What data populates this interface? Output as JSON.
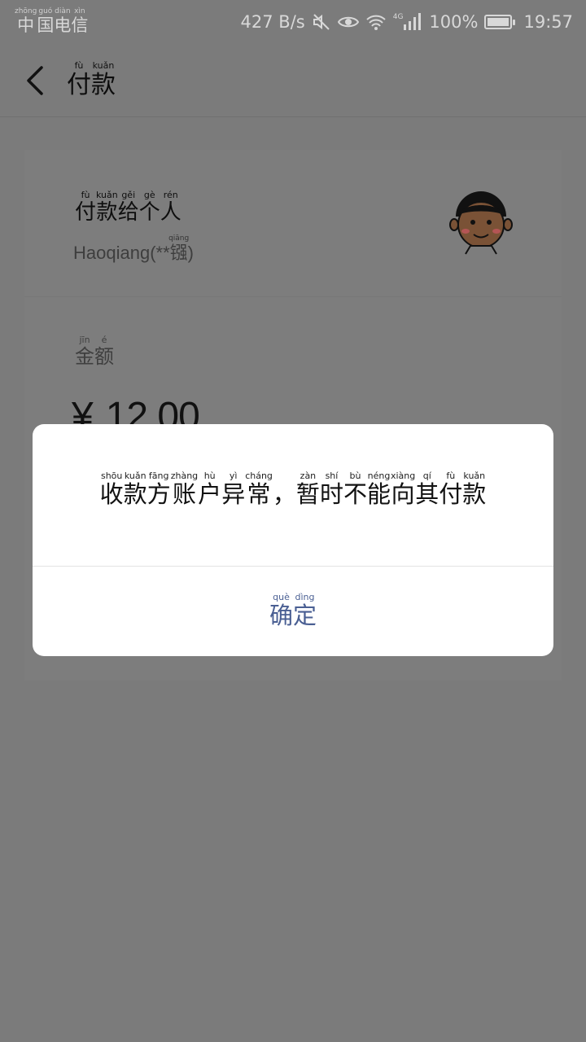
{
  "status_bar": {
    "carrier": [
      {
        "char": "中",
        "pinyin": "zhōng"
      },
      {
        "char": "国",
        "pinyin": "guó"
      },
      {
        "char": "电",
        "pinyin": "diàn"
      },
      {
        "char": "信",
        "pinyin": "xìn"
      }
    ],
    "network_speed": "427 B/s",
    "network_type": "4G",
    "battery": "100%",
    "time": "19:57",
    "icons": [
      "mute-icon",
      "eye-icon",
      "wifi-icon",
      "signal-icon",
      "battery-icon"
    ]
  },
  "header": {
    "back_icon": "chevron-left-icon",
    "title": [
      {
        "char": "付",
        "pinyin": "fù"
      },
      {
        "char": "款",
        "pinyin": "kuǎn"
      }
    ]
  },
  "payment": {
    "payee_label": [
      {
        "char": "付",
        "pinyin": "fù"
      },
      {
        "char": "款",
        "pinyin": "kuǎn"
      },
      {
        "char": "给",
        "pinyin": "gěi"
      },
      {
        "char": "个",
        "pinyin": "gè"
      },
      {
        "char": "人",
        "pinyin": "rén"
      }
    ],
    "payee_name_prefix": "Haoqiang(**",
    "payee_name_char": {
      "char": "镪",
      "pinyin": "qiāng"
    },
    "payee_name_suffix": ")",
    "amount_label": [
      {
        "char": "金",
        "pinyin": "jīn"
      },
      {
        "char": "额",
        "pinyin": "é"
      }
    ],
    "currency_symbol": "¥",
    "amount": "12.00"
  },
  "dialog": {
    "message": [
      {
        "char": "收",
        "pinyin": "shōu"
      },
      {
        "char": "款",
        "pinyin": "kuǎn"
      },
      {
        "char": "方",
        "pinyin": "fāng"
      },
      {
        "char": "账",
        "pinyin": "zhàng"
      },
      {
        "char": "户",
        "pinyin": "hù"
      },
      {
        "char": "异",
        "pinyin": "yì"
      },
      {
        "char": "常",
        "pinyin": "cháng"
      },
      {
        "char": "，",
        "pinyin": ""
      },
      {
        "char": "暂",
        "pinyin": "zàn"
      },
      {
        "char": "时",
        "pinyin": "shí"
      },
      {
        "char": "不",
        "pinyin": "bù"
      },
      {
        "char": "能",
        "pinyin": "néng"
      },
      {
        "char": "向",
        "pinyin": "xiàng"
      },
      {
        "char": "其",
        "pinyin": "qí"
      },
      {
        "char": "付",
        "pinyin": "fù"
      },
      {
        "char": "款",
        "pinyin": "kuǎn"
      }
    ],
    "confirm": [
      {
        "char": "确",
        "pinyin": "què"
      },
      {
        "char": "定",
        "pinyin": "dìng"
      }
    ]
  },
  "colors": {
    "overlay": "#7b7b7b",
    "dialog_bg": "#ffffff",
    "confirm_text": "#4a5f93"
  }
}
